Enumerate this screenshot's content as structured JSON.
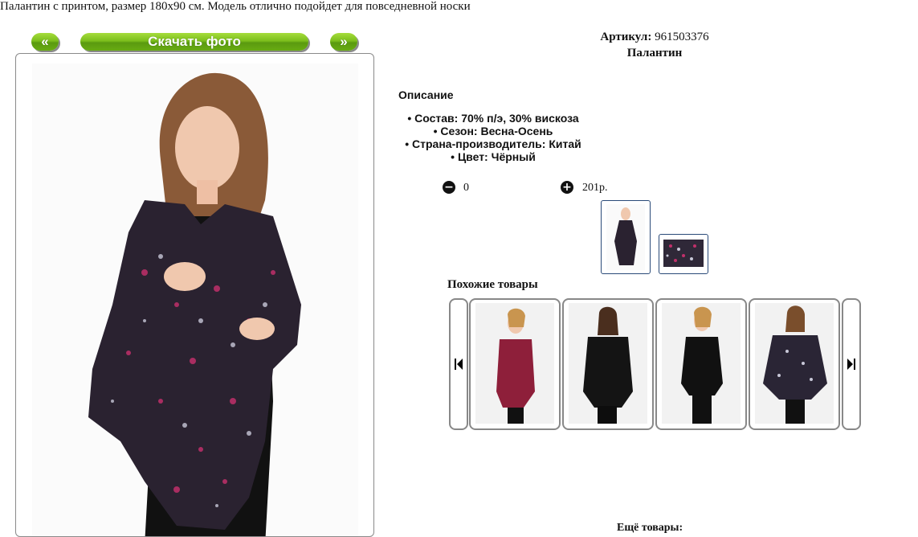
{
  "gallery": {
    "prev_label": "«",
    "download_label": "Скачать фото",
    "next_label": "»"
  },
  "product": {
    "sku_label": "Артикул:",
    "sku_value": "961503376",
    "name": "Палантин",
    "description": "Палантин с принтом, размер 180х90 см. Модель отлично подойдет для повседневной носки",
    "section_title": "Описание",
    "attributes": [
      {
        "label": "Состав:",
        "value": "70% п/э, 30% вискоза"
      },
      {
        "label": "Сезон:",
        "value": "Весна-Осень"
      },
      {
        "label": "Страна-производитель:",
        "value": "Китай"
      },
      {
        "label": "Цвет:",
        "value": "Чёрный"
      }
    ],
    "quantity": "0",
    "price": "201р."
  },
  "similar": {
    "title": "Похожие товары"
  },
  "footer": {
    "cut_text": "Ещё товары:"
  },
  "icons": {
    "minus": "minus-circle-icon",
    "plus": "plus-circle-icon",
    "carousel_prev": "skip-back-icon",
    "carousel_next": "skip-forward-icon"
  },
  "colors": {
    "button_green": "#7cbf1c",
    "thumb_border": "#2a4a78"
  }
}
